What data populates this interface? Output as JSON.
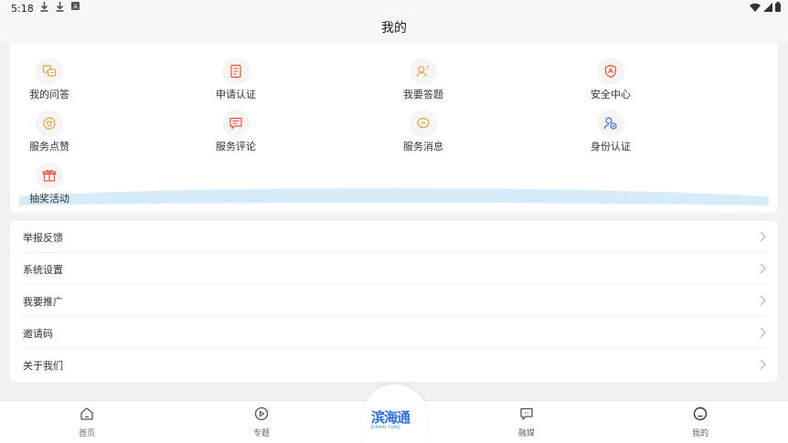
{
  "status_bar": {
    "time": "5:18",
    "icons": [
      "download-icon",
      "download-icon",
      "a-icon"
    ],
    "right_icons": [
      "wifi-icon",
      "signal-icon",
      "battery-icon"
    ]
  },
  "header": {
    "title": "我的"
  },
  "grid": {
    "items": [
      {
        "label": "我的问答",
        "icon": "qa-icon",
        "color": "#e8a24a"
      },
      {
        "label": "申请认证",
        "icon": "certificate-icon",
        "color": "#e8543a"
      },
      {
        "label": "我要答题",
        "icon": "user-question-icon",
        "color": "#e8a24a"
      },
      {
        "label": "安全中心",
        "icon": "shield-icon",
        "color": "#e8543a"
      },
      {
        "label": "服务点赞",
        "icon": "heart-icon",
        "color": "#e8a24a"
      },
      {
        "label": "服务评论",
        "icon": "comment-icon",
        "color": "#e8543a"
      },
      {
        "label": "服务消息",
        "icon": "message-icon",
        "color": "#e8a24a"
      },
      {
        "label": "身份认证",
        "icon": "identity-icon",
        "color": "#3b6fd9"
      },
      {
        "label": "抽奖活动",
        "icon": "gift-icon",
        "color": "#e8543a"
      }
    ]
  },
  "settings_list": {
    "items": [
      {
        "label": "举报反馈"
      },
      {
        "label": "系统设置"
      },
      {
        "label": "我要推广"
      },
      {
        "label": "邀请码"
      },
      {
        "label": "关于我们"
      }
    ]
  },
  "bottom_nav": {
    "items": [
      {
        "label": "首页",
        "icon": "home-icon"
      },
      {
        "label": "专题",
        "icon": "play-icon"
      },
      {
        "label": "融媒",
        "icon": "media-icon"
      },
      {
        "label": "我的",
        "icon": "profile-icon"
      }
    ],
    "logo_text": "滨海通",
    "logo_sub": "BINHAI TONG"
  },
  "colors": {
    "accent_blue": "#2f6fe0",
    "wave": "#d7ecf9",
    "background": "#f2f2f2"
  }
}
